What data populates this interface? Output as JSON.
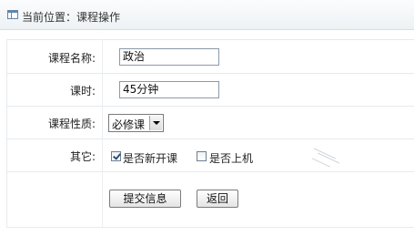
{
  "header": {
    "title": "当前位置：课程操作",
    "icon": "window-icon"
  },
  "form": {
    "fields": {
      "course_name": {
        "label": "课程名称:",
        "value": "政治"
      },
      "duration": {
        "label": "课时:",
        "value": "45分钟"
      },
      "course_type": {
        "label": "课程性质:",
        "selected": "必修课"
      },
      "other": {
        "label": "其它:",
        "options": [
          {
            "label": "是否新开课",
            "checked": true
          },
          {
            "label": "是否上机",
            "checked": false
          }
        ]
      }
    },
    "buttons": {
      "submit": "提交信息",
      "back": "返回"
    }
  }
}
